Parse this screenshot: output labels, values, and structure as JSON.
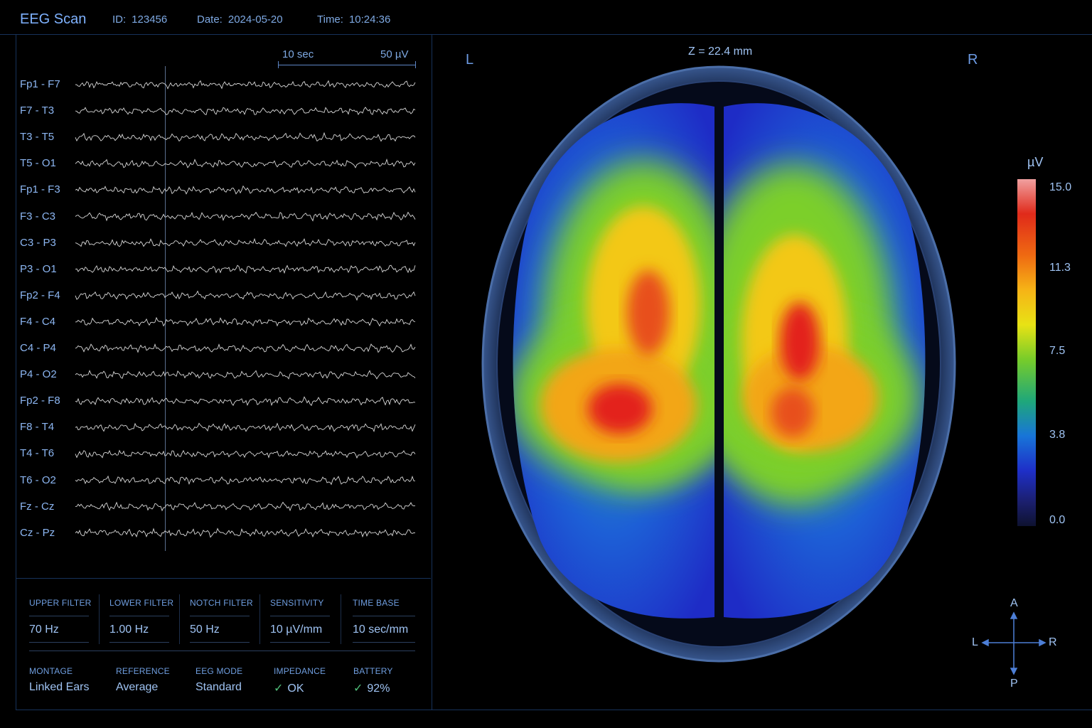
{
  "header": {
    "title": "EEG Scan",
    "id_label": "ID:",
    "id_value": "123456",
    "date_label": "Date:",
    "date_value": "2024-05-20",
    "time_label": "Time:",
    "time_value": "10:24:36"
  },
  "scale": {
    "time": "10 sec",
    "amplitude": "50 µV"
  },
  "channels": [
    "Fp1 - F7",
    "F7 - T3",
    "T3 - T5",
    "T5 - O1",
    "Fp1 - F3",
    "F3 - C3",
    "C3 - P3",
    "P3 - O1",
    "Fp2 - F4",
    "F4 - C4",
    "C4 - P4",
    "P4 - O2",
    "Fp2 - F8",
    "F8 - T4",
    "T4 - T6",
    "T6 - O2",
    "Fz - Cz",
    "Cz - Pz"
  ],
  "settings": {
    "upper_filter": {
      "label": "UPPER FILTER",
      "value": "70 Hz"
    },
    "lower_filter": {
      "label": "LOWER FILTER",
      "value": "1.00 Hz"
    },
    "notch_filter": {
      "label": "NOTCH FILTER",
      "value": "50 Hz"
    },
    "sensitivity": {
      "label": "SENSITIVITY",
      "value": "10 µV/mm"
    },
    "time_base": {
      "label": "TIME BASE",
      "value": "10 sec/mm"
    },
    "montage": {
      "label": "MONTAGE",
      "value": "Linked Ears"
    },
    "reference": {
      "label": "REFERENCE",
      "value": "Average"
    },
    "eeg_mode": {
      "label": "EEG MODE",
      "value": "Standard"
    },
    "impedance": {
      "label": "IMPEDANCE",
      "value": "OK"
    },
    "battery": {
      "label": "BATTERY",
      "value": "92%"
    }
  },
  "brain_map": {
    "left": "L",
    "right": "R",
    "slice": "Z = 22.4 mm"
  },
  "colorbar": {
    "unit": "µV",
    "ticks": [
      "15.0",
      "11.3",
      "7.5",
      "3.8",
      "0.0"
    ]
  },
  "orientation": {
    "anterior": "A",
    "posterior": "P",
    "left": "L",
    "right": "R"
  },
  "icons": {
    "ok": "check-icon"
  },
  "colors": {
    "accent": "#7fb2ff",
    "ok": "#4fc07a",
    "trace": "#d8d8d8",
    "background": "#000000"
  }
}
